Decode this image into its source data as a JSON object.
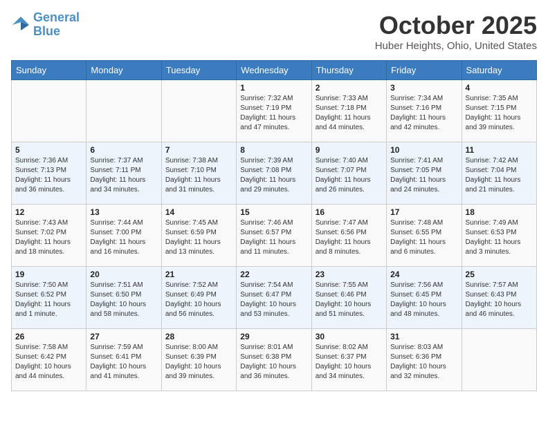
{
  "header": {
    "logo_line1": "General",
    "logo_line2": "Blue",
    "month": "October 2025",
    "location": "Huber Heights, Ohio, United States"
  },
  "weekdays": [
    "Sunday",
    "Monday",
    "Tuesday",
    "Wednesday",
    "Thursday",
    "Friday",
    "Saturday"
  ],
  "weeks": [
    [
      {
        "day": "",
        "info": ""
      },
      {
        "day": "",
        "info": ""
      },
      {
        "day": "",
        "info": ""
      },
      {
        "day": "1",
        "info": "Sunrise: 7:32 AM\nSunset: 7:19 PM\nDaylight: 11 hours and 47 minutes."
      },
      {
        "day": "2",
        "info": "Sunrise: 7:33 AM\nSunset: 7:18 PM\nDaylight: 11 hours and 44 minutes."
      },
      {
        "day": "3",
        "info": "Sunrise: 7:34 AM\nSunset: 7:16 PM\nDaylight: 11 hours and 42 minutes."
      },
      {
        "day": "4",
        "info": "Sunrise: 7:35 AM\nSunset: 7:15 PM\nDaylight: 11 hours and 39 minutes."
      }
    ],
    [
      {
        "day": "5",
        "info": "Sunrise: 7:36 AM\nSunset: 7:13 PM\nDaylight: 11 hours and 36 minutes."
      },
      {
        "day": "6",
        "info": "Sunrise: 7:37 AM\nSunset: 7:11 PM\nDaylight: 11 hours and 34 minutes."
      },
      {
        "day": "7",
        "info": "Sunrise: 7:38 AM\nSunset: 7:10 PM\nDaylight: 11 hours and 31 minutes."
      },
      {
        "day": "8",
        "info": "Sunrise: 7:39 AM\nSunset: 7:08 PM\nDaylight: 11 hours and 29 minutes."
      },
      {
        "day": "9",
        "info": "Sunrise: 7:40 AM\nSunset: 7:07 PM\nDaylight: 11 hours and 26 minutes."
      },
      {
        "day": "10",
        "info": "Sunrise: 7:41 AM\nSunset: 7:05 PM\nDaylight: 11 hours and 24 minutes."
      },
      {
        "day": "11",
        "info": "Sunrise: 7:42 AM\nSunset: 7:04 PM\nDaylight: 11 hours and 21 minutes."
      }
    ],
    [
      {
        "day": "12",
        "info": "Sunrise: 7:43 AM\nSunset: 7:02 PM\nDaylight: 11 hours and 18 minutes."
      },
      {
        "day": "13",
        "info": "Sunrise: 7:44 AM\nSunset: 7:00 PM\nDaylight: 11 hours and 16 minutes."
      },
      {
        "day": "14",
        "info": "Sunrise: 7:45 AM\nSunset: 6:59 PM\nDaylight: 11 hours and 13 minutes."
      },
      {
        "day": "15",
        "info": "Sunrise: 7:46 AM\nSunset: 6:57 PM\nDaylight: 11 hours and 11 minutes."
      },
      {
        "day": "16",
        "info": "Sunrise: 7:47 AM\nSunset: 6:56 PM\nDaylight: 11 hours and 8 minutes."
      },
      {
        "day": "17",
        "info": "Sunrise: 7:48 AM\nSunset: 6:55 PM\nDaylight: 11 hours and 6 minutes."
      },
      {
        "day": "18",
        "info": "Sunrise: 7:49 AM\nSunset: 6:53 PM\nDaylight: 11 hours and 3 minutes."
      }
    ],
    [
      {
        "day": "19",
        "info": "Sunrise: 7:50 AM\nSunset: 6:52 PM\nDaylight: 11 hours and 1 minute."
      },
      {
        "day": "20",
        "info": "Sunrise: 7:51 AM\nSunset: 6:50 PM\nDaylight: 10 hours and 58 minutes."
      },
      {
        "day": "21",
        "info": "Sunrise: 7:52 AM\nSunset: 6:49 PM\nDaylight: 10 hours and 56 minutes."
      },
      {
        "day": "22",
        "info": "Sunrise: 7:54 AM\nSunset: 6:47 PM\nDaylight: 10 hours and 53 minutes."
      },
      {
        "day": "23",
        "info": "Sunrise: 7:55 AM\nSunset: 6:46 PM\nDaylight: 10 hours and 51 minutes."
      },
      {
        "day": "24",
        "info": "Sunrise: 7:56 AM\nSunset: 6:45 PM\nDaylight: 10 hours and 48 minutes."
      },
      {
        "day": "25",
        "info": "Sunrise: 7:57 AM\nSunset: 6:43 PM\nDaylight: 10 hours and 46 minutes."
      }
    ],
    [
      {
        "day": "26",
        "info": "Sunrise: 7:58 AM\nSunset: 6:42 PM\nDaylight: 10 hours and 44 minutes."
      },
      {
        "day": "27",
        "info": "Sunrise: 7:59 AM\nSunset: 6:41 PM\nDaylight: 10 hours and 41 minutes."
      },
      {
        "day": "28",
        "info": "Sunrise: 8:00 AM\nSunset: 6:39 PM\nDaylight: 10 hours and 39 minutes."
      },
      {
        "day": "29",
        "info": "Sunrise: 8:01 AM\nSunset: 6:38 PM\nDaylight: 10 hours and 36 minutes."
      },
      {
        "day": "30",
        "info": "Sunrise: 8:02 AM\nSunset: 6:37 PM\nDaylight: 10 hours and 34 minutes."
      },
      {
        "day": "31",
        "info": "Sunrise: 8:03 AM\nSunset: 6:36 PM\nDaylight: 10 hours and 32 minutes."
      },
      {
        "day": "",
        "info": ""
      }
    ]
  ]
}
